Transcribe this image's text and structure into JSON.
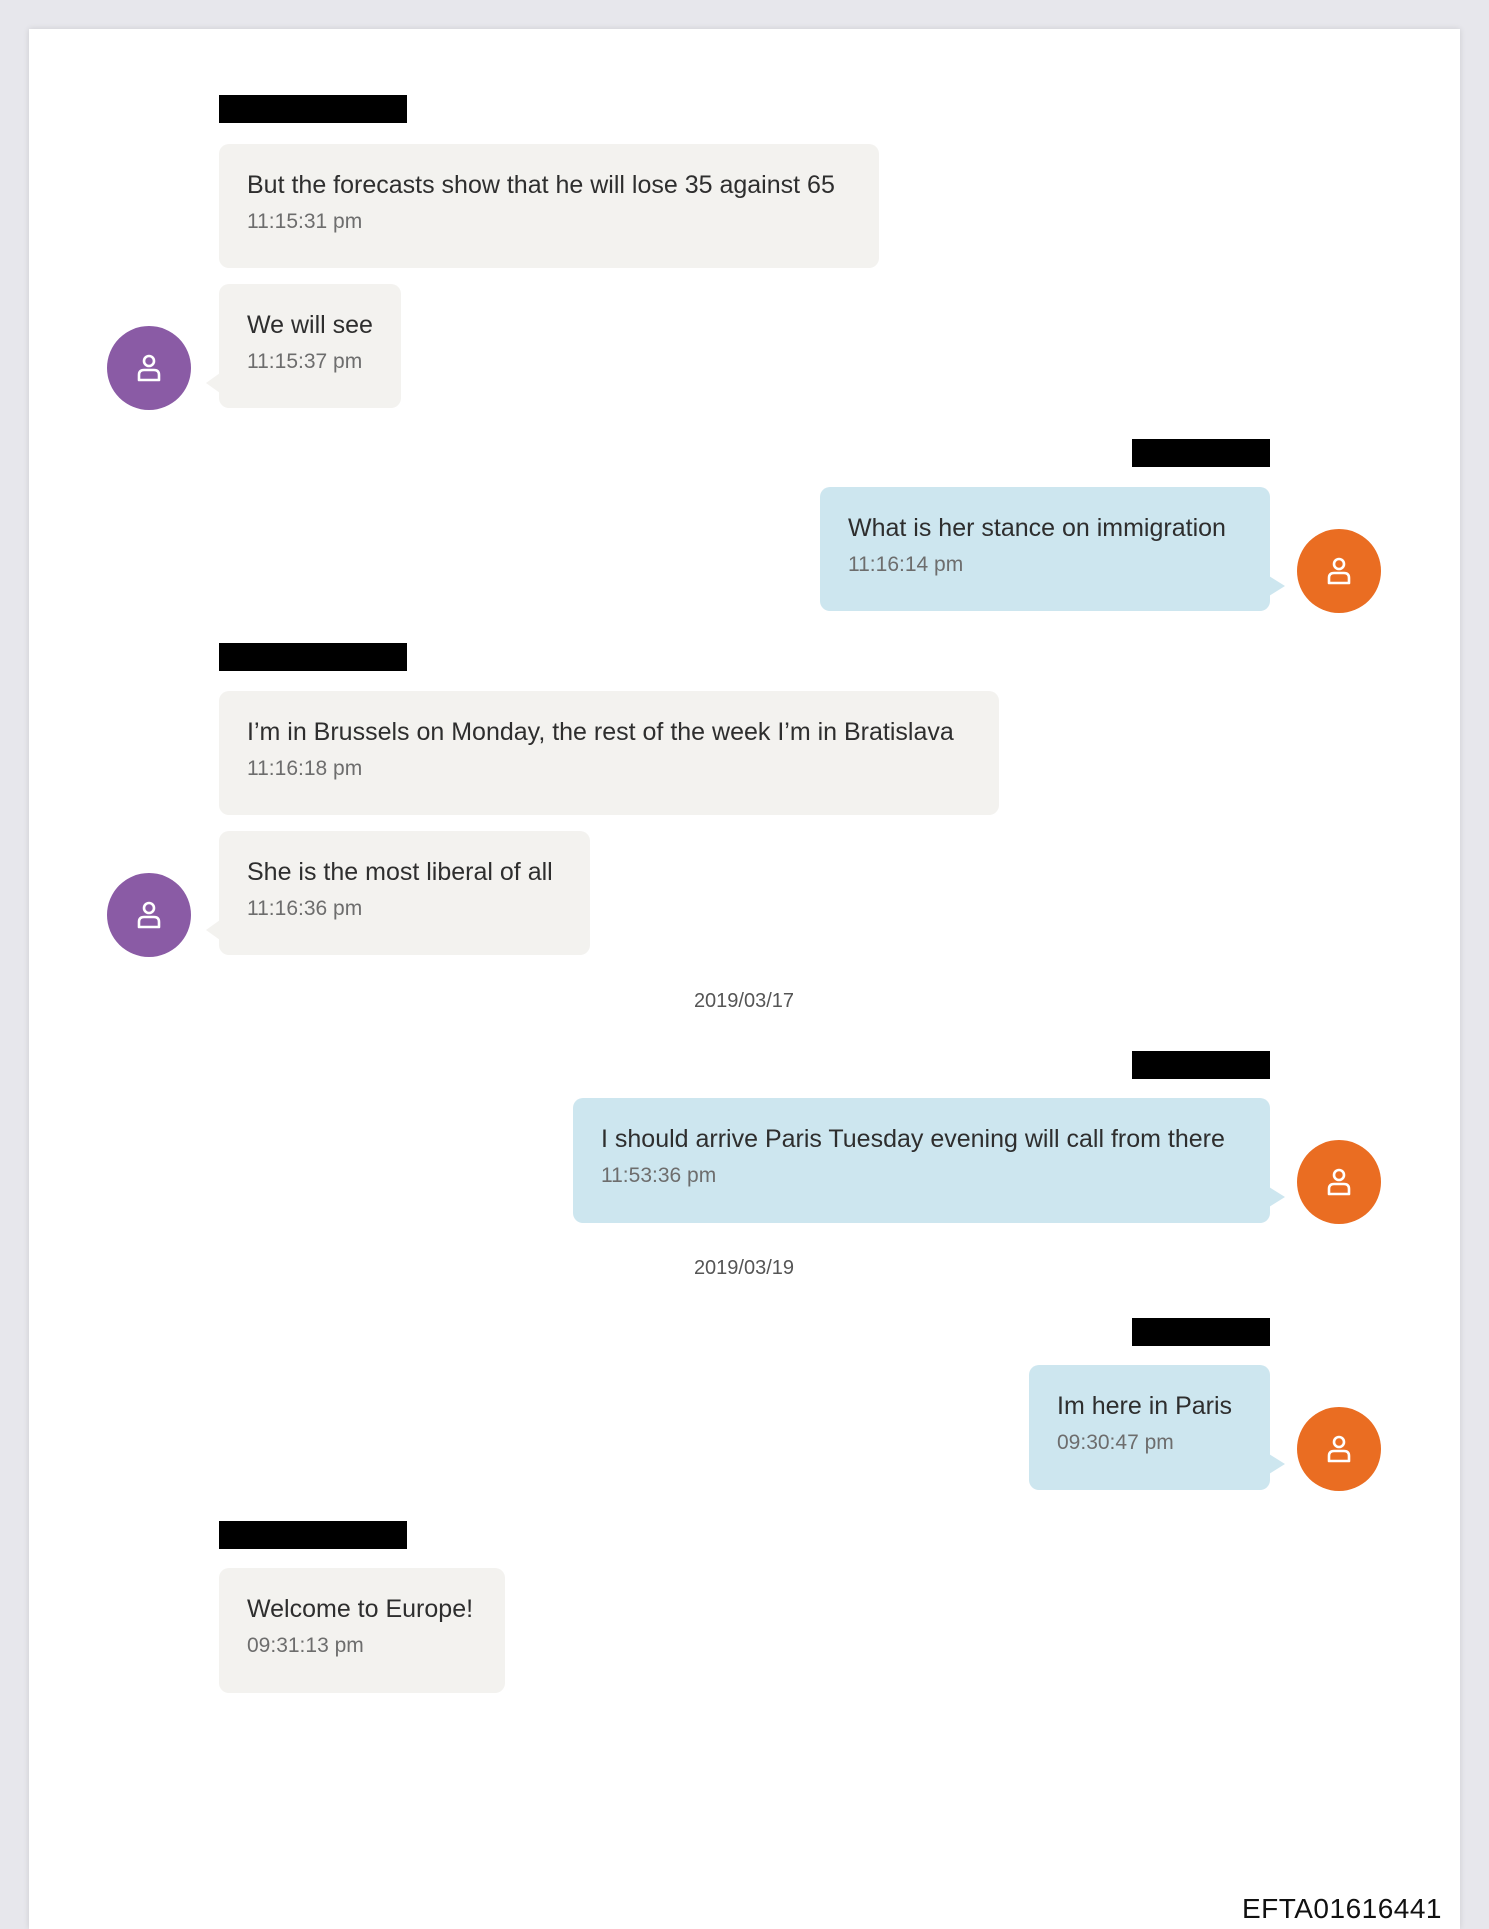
{
  "colors": {
    "incoming_bubble": "#f3f2ef",
    "outgoing_bubble": "#cde6ef",
    "incoming_avatar": "#8a5ba5",
    "outgoing_avatar": "#ea6d22",
    "redaction": "#000000"
  },
  "icons": {
    "avatar": "person-icon"
  },
  "messages": [
    {
      "text": "But the forecasts show that he will lose 35 against 65",
      "time": "11:15:31 pm",
      "direction": "incoming"
    },
    {
      "text": "We will see",
      "time": "11:15:37 pm",
      "direction": "incoming"
    },
    {
      "text": "What is her stance on immigration",
      "time": "11:16:14 pm",
      "direction": "outgoing"
    },
    {
      "text": "I’m in Brussels on Monday, the rest of the week I’m in Bratislava",
      "time": "11:16:18 pm",
      "direction": "incoming"
    },
    {
      "text": "She is the most liberal of all",
      "time": "11:16:36 pm",
      "direction": "incoming"
    },
    {
      "text": "I should arrive Paris Tuesday evening will call from there",
      "time": "11:53:36 pm",
      "direction": "outgoing"
    },
    {
      "text": "Im here in Paris",
      "time": "09:30:47 pm",
      "direction": "outgoing"
    },
    {
      "text": "Welcome to Europe!",
      "time": "09:31:13 pm",
      "direction": "incoming"
    }
  ],
  "date_separators": [
    "2019/03/17",
    "2019/03/19"
  ],
  "footer": {
    "doc_id": "EFTA01616441"
  }
}
